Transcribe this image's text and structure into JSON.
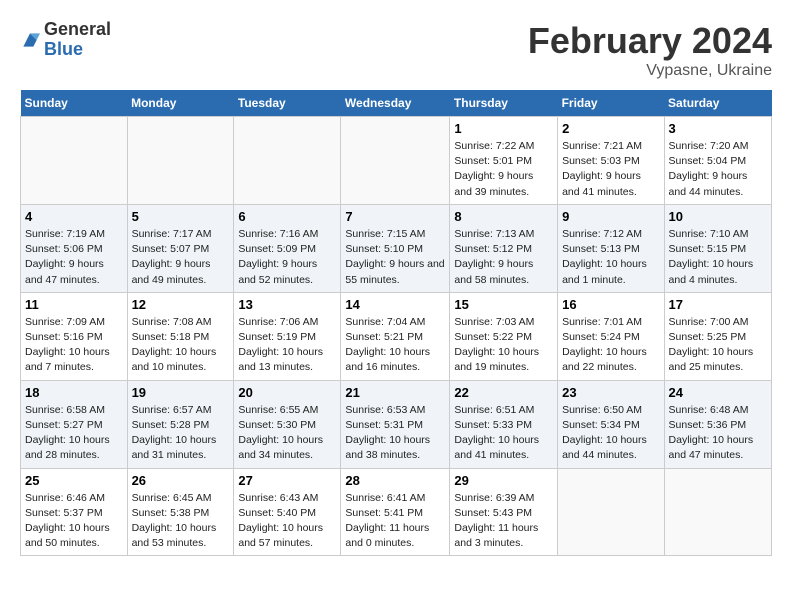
{
  "header": {
    "logo_general": "General",
    "logo_blue": "Blue",
    "title": "February 2024",
    "location": "Vypasne, Ukraine"
  },
  "days_of_week": [
    "Sunday",
    "Monday",
    "Tuesday",
    "Wednesday",
    "Thursday",
    "Friday",
    "Saturday"
  ],
  "weeks": [
    [
      {
        "day": "",
        "empty": true
      },
      {
        "day": "",
        "empty": true
      },
      {
        "day": "",
        "empty": true
      },
      {
        "day": "",
        "empty": true
      },
      {
        "day": "1",
        "sunrise": "7:22 AM",
        "sunset": "5:01 PM",
        "daylight": "9 hours and 39 minutes."
      },
      {
        "day": "2",
        "sunrise": "7:21 AM",
        "sunset": "5:03 PM",
        "daylight": "9 hours and 41 minutes."
      },
      {
        "day": "3",
        "sunrise": "7:20 AM",
        "sunset": "5:04 PM",
        "daylight": "9 hours and 44 minutes."
      }
    ],
    [
      {
        "day": "4",
        "sunrise": "7:19 AM",
        "sunset": "5:06 PM",
        "daylight": "9 hours and 47 minutes."
      },
      {
        "day": "5",
        "sunrise": "7:17 AM",
        "sunset": "5:07 PM",
        "daylight": "9 hours and 49 minutes."
      },
      {
        "day": "6",
        "sunrise": "7:16 AM",
        "sunset": "5:09 PM",
        "daylight": "9 hours and 52 minutes."
      },
      {
        "day": "7",
        "sunrise": "7:15 AM",
        "sunset": "5:10 PM",
        "daylight": "9 hours and 55 minutes."
      },
      {
        "day": "8",
        "sunrise": "7:13 AM",
        "sunset": "5:12 PM",
        "daylight": "9 hours and 58 minutes."
      },
      {
        "day": "9",
        "sunrise": "7:12 AM",
        "sunset": "5:13 PM",
        "daylight": "10 hours and 1 minute."
      },
      {
        "day": "10",
        "sunrise": "7:10 AM",
        "sunset": "5:15 PM",
        "daylight": "10 hours and 4 minutes."
      }
    ],
    [
      {
        "day": "11",
        "sunrise": "7:09 AM",
        "sunset": "5:16 PM",
        "daylight": "10 hours and 7 minutes."
      },
      {
        "day": "12",
        "sunrise": "7:08 AM",
        "sunset": "5:18 PM",
        "daylight": "10 hours and 10 minutes."
      },
      {
        "day": "13",
        "sunrise": "7:06 AM",
        "sunset": "5:19 PM",
        "daylight": "10 hours and 13 minutes."
      },
      {
        "day": "14",
        "sunrise": "7:04 AM",
        "sunset": "5:21 PM",
        "daylight": "10 hours and 16 minutes."
      },
      {
        "day": "15",
        "sunrise": "7:03 AM",
        "sunset": "5:22 PM",
        "daylight": "10 hours and 19 minutes."
      },
      {
        "day": "16",
        "sunrise": "7:01 AM",
        "sunset": "5:24 PM",
        "daylight": "10 hours and 22 minutes."
      },
      {
        "day": "17",
        "sunrise": "7:00 AM",
        "sunset": "5:25 PM",
        "daylight": "10 hours and 25 minutes."
      }
    ],
    [
      {
        "day": "18",
        "sunrise": "6:58 AM",
        "sunset": "5:27 PM",
        "daylight": "10 hours and 28 minutes."
      },
      {
        "day": "19",
        "sunrise": "6:57 AM",
        "sunset": "5:28 PM",
        "daylight": "10 hours and 31 minutes."
      },
      {
        "day": "20",
        "sunrise": "6:55 AM",
        "sunset": "5:30 PM",
        "daylight": "10 hours and 34 minutes."
      },
      {
        "day": "21",
        "sunrise": "6:53 AM",
        "sunset": "5:31 PM",
        "daylight": "10 hours and 38 minutes."
      },
      {
        "day": "22",
        "sunrise": "6:51 AM",
        "sunset": "5:33 PM",
        "daylight": "10 hours and 41 minutes."
      },
      {
        "day": "23",
        "sunrise": "6:50 AM",
        "sunset": "5:34 PM",
        "daylight": "10 hours and 44 minutes."
      },
      {
        "day": "24",
        "sunrise": "6:48 AM",
        "sunset": "5:36 PM",
        "daylight": "10 hours and 47 minutes."
      }
    ],
    [
      {
        "day": "25",
        "sunrise": "6:46 AM",
        "sunset": "5:37 PM",
        "daylight": "10 hours and 50 minutes."
      },
      {
        "day": "26",
        "sunrise": "6:45 AM",
        "sunset": "5:38 PM",
        "daylight": "10 hours and 53 minutes."
      },
      {
        "day": "27",
        "sunrise": "6:43 AM",
        "sunset": "5:40 PM",
        "daylight": "10 hours and 57 minutes."
      },
      {
        "day": "28",
        "sunrise": "6:41 AM",
        "sunset": "5:41 PM",
        "daylight": "11 hours and 0 minutes."
      },
      {
        "day": "29",
        "sunrise": "6:39 AM",
        "sunset": "5:43 PM",
        "daylight": "11 hours and 3 minutes."
      },
      {
        "day": "",
        "empty": true
      },
      {
        "day": "",
        "empty": true
      }
    ]
  ],
  "labels": {
    "sunrise": "Sunrise: ",
    "sunset": "Sunset: ",
    "daylight": "Daylight: "
  }
}
